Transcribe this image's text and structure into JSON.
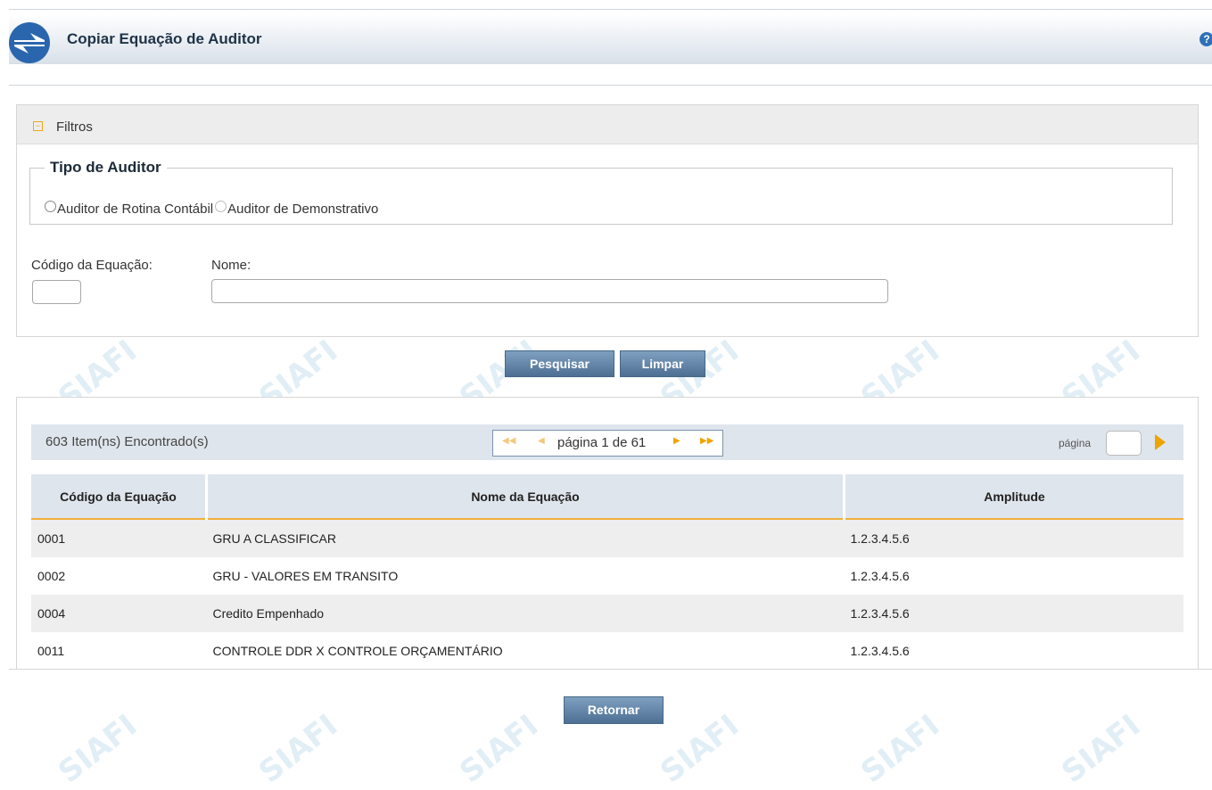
{
  "header": {
    "title": "Copiar Equação de Auditor",
    "help_symbol": "?"
  },
  "filters": {
    "section_label": "Filtros",
    "tipo_legend": "Tipo de Auditor",
    "radio_rotina": "Auditor de Rotina Contábil",
    "radio_demonstrativo": "Auditor de Demonstrativo",
    "codigo_label": "Código da Equação:",
    "codigo_value": "",
    "nome_label": "Nome:",
    "nome_value": ""
  },
  "actions": {
    "search": "Pesquisar",
    "clear": "Limpar",
    "back": "Retornar"
  },
  "results": {
    "count_text": "603 Item(ns) Encontrado(s)",
    "pager_text": "página 1 de 61",
    "page_label": "página",
    "page_value": "",
    "columns": [
      "Código da Equação",
      "Nome da Equação",
      "Amplitude"
    ],
    "rows": [
      [
        "0001",
        "GRU A CLASSIFICAR",
        "1.2.3.4.5.6"
      ],
      [
        "0002",
        "GRU - VALORES EM TRANSITO",
        "1.2.3.4.5.6"
      ],
      [
        "0004",
        "Credito Empenhado",
        "1.2.3.4.5.6"
      ],
      [
        "0011",
        "CONTROLE DDR X CONTROLE ORÇAMENTÁRIO",
        "1.2.3.4.5.6"
      ]
    ]
  },
  "colors": {
    "accent": "#f0a400",
    "button": "#5a7ca0",
    "header_bar": "#dfe5ec"
  }
}
